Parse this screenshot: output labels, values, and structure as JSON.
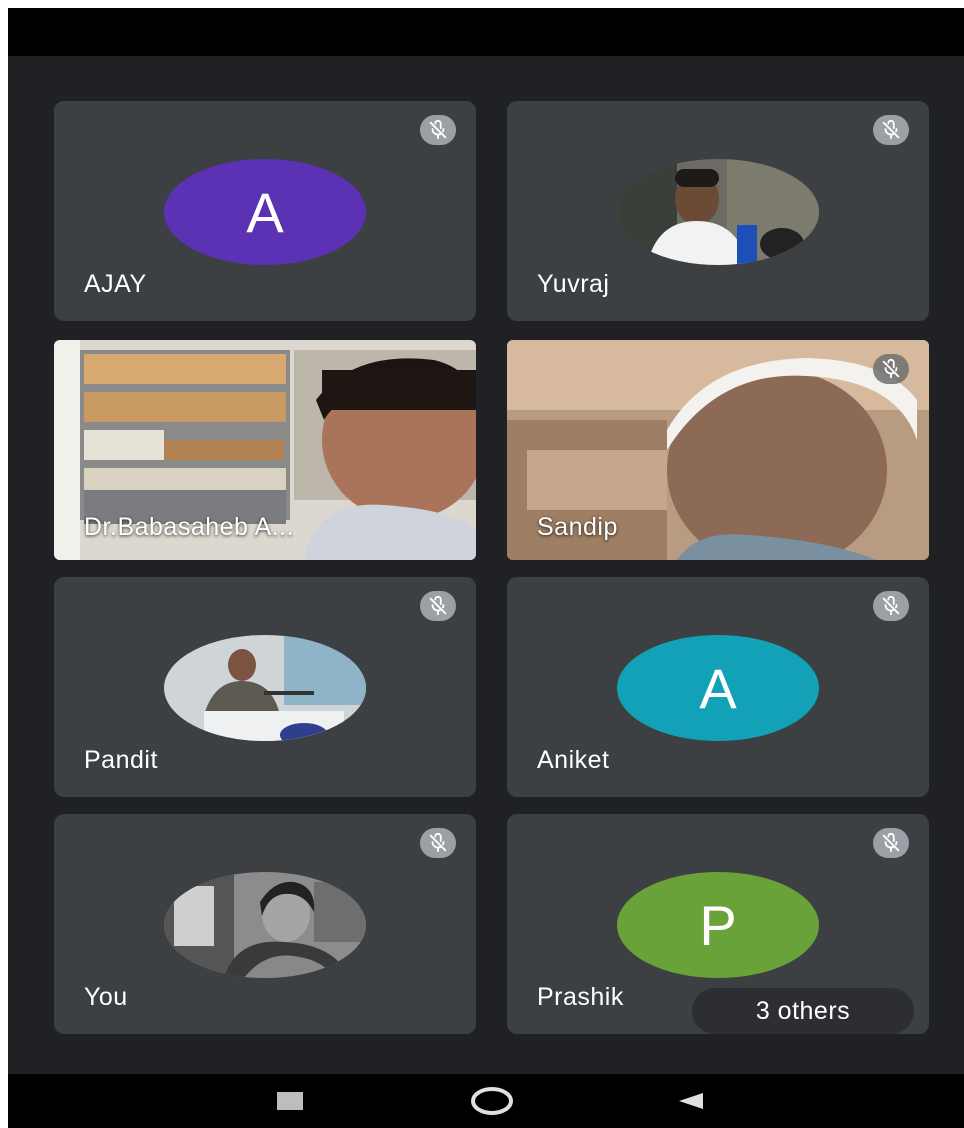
{
  "participants": [
    {
      "name": "AJAY",
      "initial": "A",
      "avatar_color": "#5b32b4",
      "muted": true
    },
    {
      "name": "Yuvraj",
      "muted": true
    },
    {
      "name": "Dr.Babasaheb A...",
      "muted": false
    },
    {
      "name": "Sandip",
      "muted": true
    },
    {
      "name": "Pandit",
      "muted": true
    },
    {
      "name": "Aniket",
      "initial": "A",
      "avatar_color": "#12a1b7",
      "muted": true
    },
    {
      "name": "You",
      "muted": true
    },
    {
      "name": "Prashik",
      "initial": "P",
      "avatar_color": "#6aa23a",
      "muted": true
    }
  ],
  "others_badge": "3 others",
  "nav": {
    "recents_icon": "square-icon",
    "home_icon": "circle-icon",
    "back_icon": "triangle-back-icon"
  },
  "colors": {
    "background": "#202124",
    "tile": "#3c4043"
  }
}
